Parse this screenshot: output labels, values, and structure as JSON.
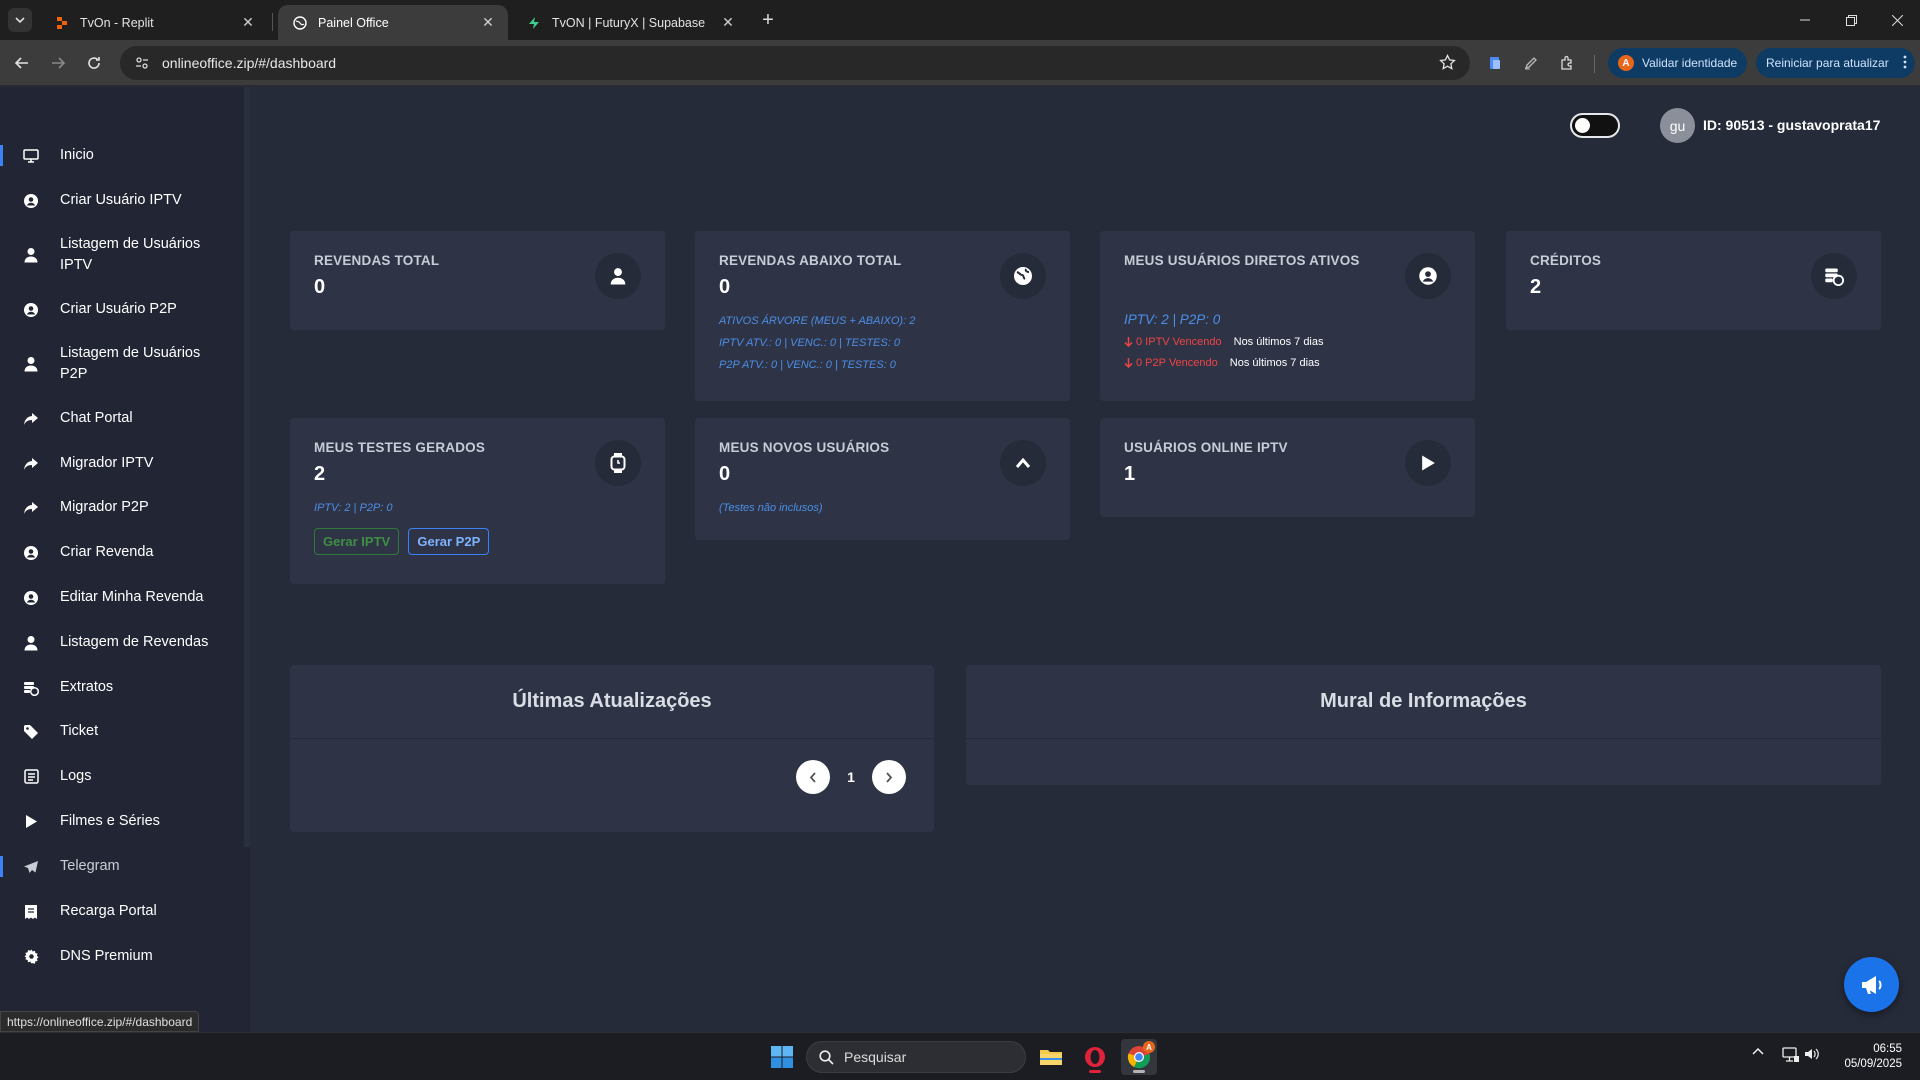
{
  "browser": {
    "tabs": [
      {
        "title": "TvOn - Replit",
        "active": false
      },
      {
        "title": "Painel Office",
        "active": true
      },
      {
        "title": "TvON | FuturyX | Supabase",
        "active": false
      }
    ],
    "url": "onlineoffice.zip/#/dashboard",
    "validate_label": "Validar identidade",
    "restart_label": "Reiniciar para atualizar",
    "status_url": "https://onlineoffice.zip/#/dashboard"
  },
  "sidebar": {
    "items": [
      {
        "label": "Inicio",
        "icon": "monitor-icon"
      },
      {
        "label": "Criar Usuário IPTV",
        "icon": "user-circle-icon"
      },
      {
        "label": "Listagem de Usuários IPTV",
        "icon": "user-icon"
      },
      {
        "label": "Criar Usuário P2P",
        "icon": "user-circle-icon"
      },
      {
        "label": "Listagem de Usuários P2P",
        "icon": "user-icon"
      },
      {
        "label": "Chat Portal",
        "icon": "share-icon"
      },
      {
        "label": "Migrador IPTV",
        "icon": "share-icon"
      },
      {
        "label": "Migrador P2P",
        "icon": "share-icon"
      },
      {
        "label": "Criar Revenda",
        "icon": "user-circle-icon"
      },
      {
        "label": "Editar Minha Revenda",
        "icon": "user-circle-icon"
      },
      {
        "label": "Listagem de Revendas",
        "icon": "user-icon"
      },
      {
        "label": "Extratos",
        "icon": "coins-icon"
      },
      {
        "label": "Ticket",
        "icon": "tag-icon"
      },
      {
        "label": "Logs",
        "icon": "log-icon"
      },
      {
        "label": "Filmes e Séries",
        "icon": "play-icon"
      },
      {
        "label": "Telegram",
        "icon": "telegram-icon"
      },
      {
        "label": "Recarga Portal",
        "icon": "receipt-icon"
      },
      {
        "label": "DNS Premium",
        "icon": "gear-icon"
      }
    ]
  },
  "header": {
    "avatar_initials": "gu",
    "user_id": "ID: 90513 - gustavoprata17"
  },
  "cards": {
    "revendas_total": {
      "title": "REVENDAS TOTAL",
      "value": "0"
    },
    "revendas_abaixo": {
      "title": "REVENDAS ABAIXO TOTAL",
      "value": "0",
      "line1": "ATIVOS ÁRVORE (MEUS + ABAIXO): 2",
      "line2": "IPTV ATV.: 0 | VENC.: 0 | TESTES: 0",
      "line3": "P2P ATV.: 0 | VENC.: 0 | TESTES: 0"
    },
    "usuarios_diretos": {
      "title": "MEUS USUÁRIOS DIRETOS ATIVOS",
      "summary": "IPTV: 2 | P2P: 0",
      "iptv_vencendo": "0 IPTV Vencendo",
      "p2p_vencendo": "0 P2P Vencendo",
      "period": "Nos últimos 7 dias"
    },
    "creditos": {
      "title": "CRÉDITOS",
      "value": "2"
    },
    "testes": {
      "title": "MEUS TESTES GERADOS",
      "value": "2",
      "summary": "IPTV: 2 | P2P: 0",
      "btn_iptv": "Gerar IPTV",
      "btn_p2p": "Gerar P2P"
    },
    "novos_usuarios": {
      "title": "MEUS NOVOS USUÁRIOS",
      "value": "0",
      "note": "(Testes não inclusos)"
    },
    "online": {
      "title": "USUÁRIOS ONLINE IPTV",
      "value": "1"
    }
  },
  "panels": {
    "updates_title": "Últimas Atualizações",
    "page": "1",
    "mural_title": "Mural de Informações"
  },
  "taskbar": {
    "search_placeholder": "Pesquisar",
    "time": "06:55",
    "date": "05/09/2025"
  },
  "colors": {
    "background": "#262b39",
    "card": "#2e3446",
    "sidebar": "#222634",
    "accent_blue": "#3b82f6",
    "danger_red": "#ef4444"
  }
}
